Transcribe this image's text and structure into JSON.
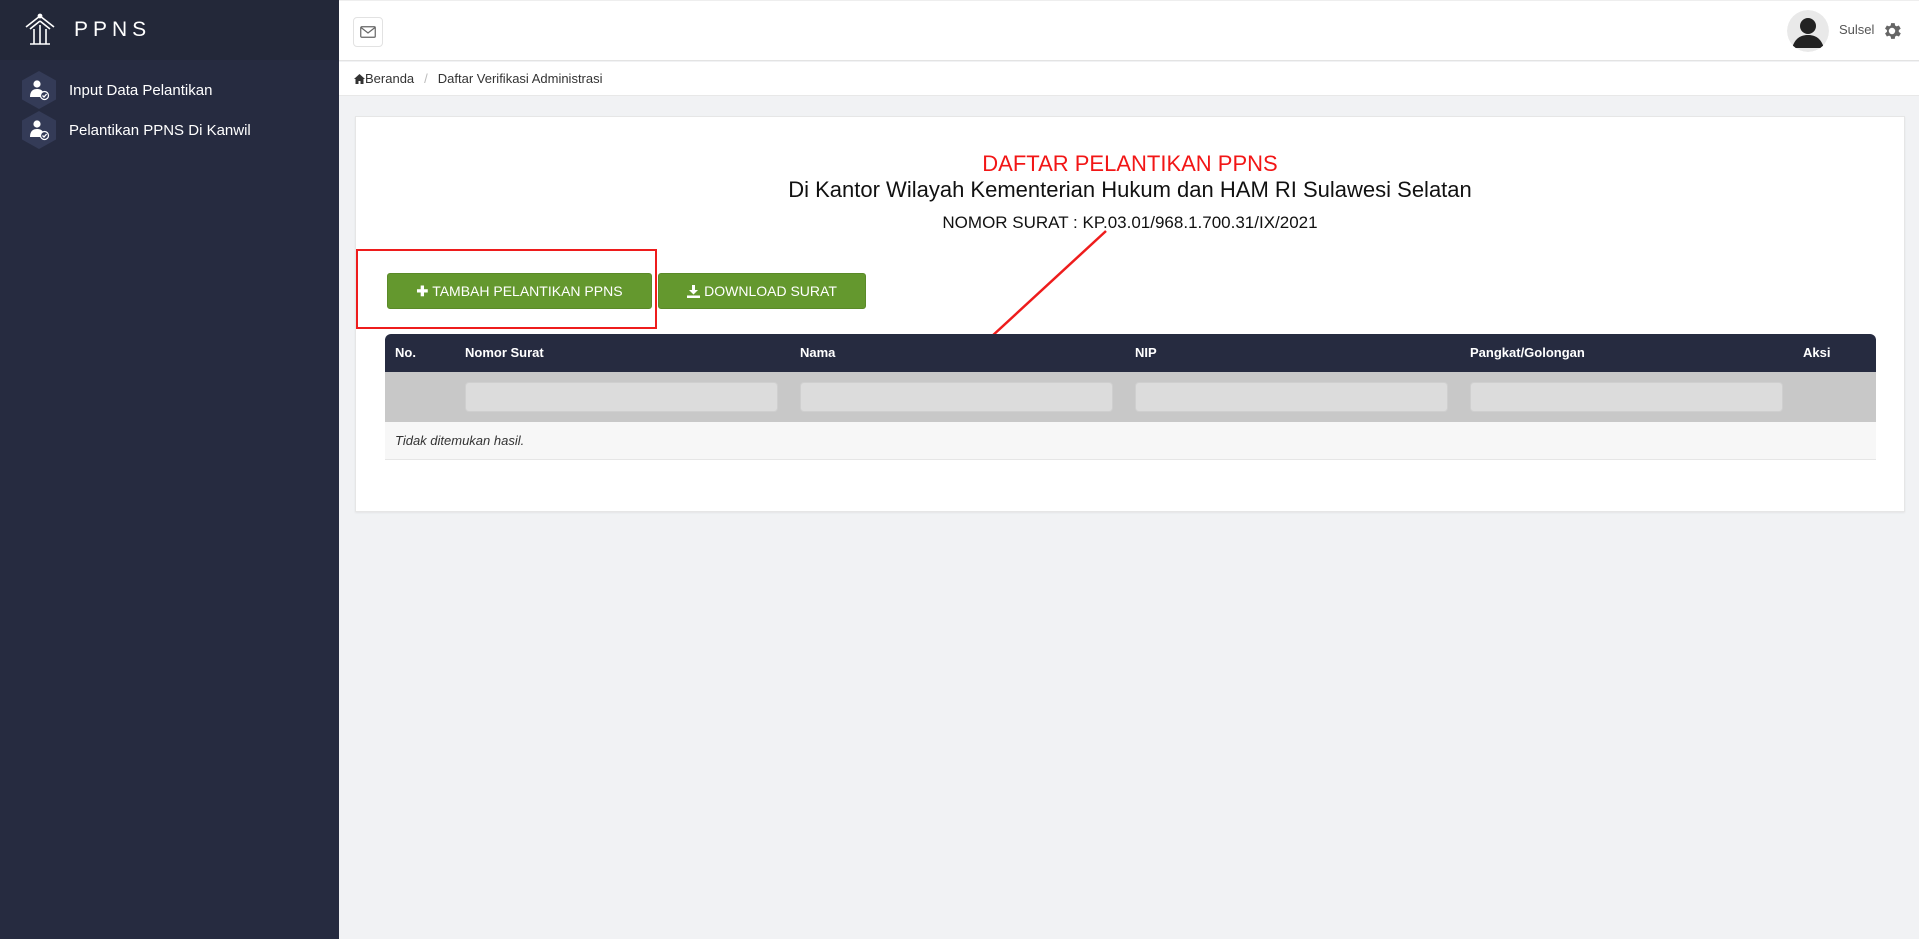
{
  "sidebar": {
    "brand": "PPNS",
    "items": [
      {
        "label": "Input Data Pelantikan"
      },
      {
        "label": "Pelantikan PPNS Di Kanwil"
      }
    ]
  },
  "topbar": {
    "user_name": "Sulsel"
  },
  "breadcrumb": {
    "home": "Beranda",
    "current": "Daftar Verifikasi Administrasi"
  },
  "card": {
    "title": "DAFTAR PELANTIKAN PPNS",
    "subtitle": "Di Kantor Wilayah Kementerian Hukum dan HAM RI Sulawesi Selatan",
    "letter_number": "NOMOR SURAT : KP.03.01/968.1.700.31/IX/2021",
    "add_button": "TAMBAH PELANTIKAN PPNS",
    "download_button": "DOWNLOAD SURAT"
  },
  "table": {
    "columns": [
      "No.",
      "Nomor Surat",
      "Nama",
      "NIP",
      "Pangkat/Golongan",
      "Aksi"
    ],
    "empty_message": "Tidak ditemukan hasil."
  },
  "colors": {
    "sidebar_bg": "#262b40",
    "button_green": "#64982e",
    "title_red": "#f21616",
    "highlight_red": "#ee1c1c"
  }
}
